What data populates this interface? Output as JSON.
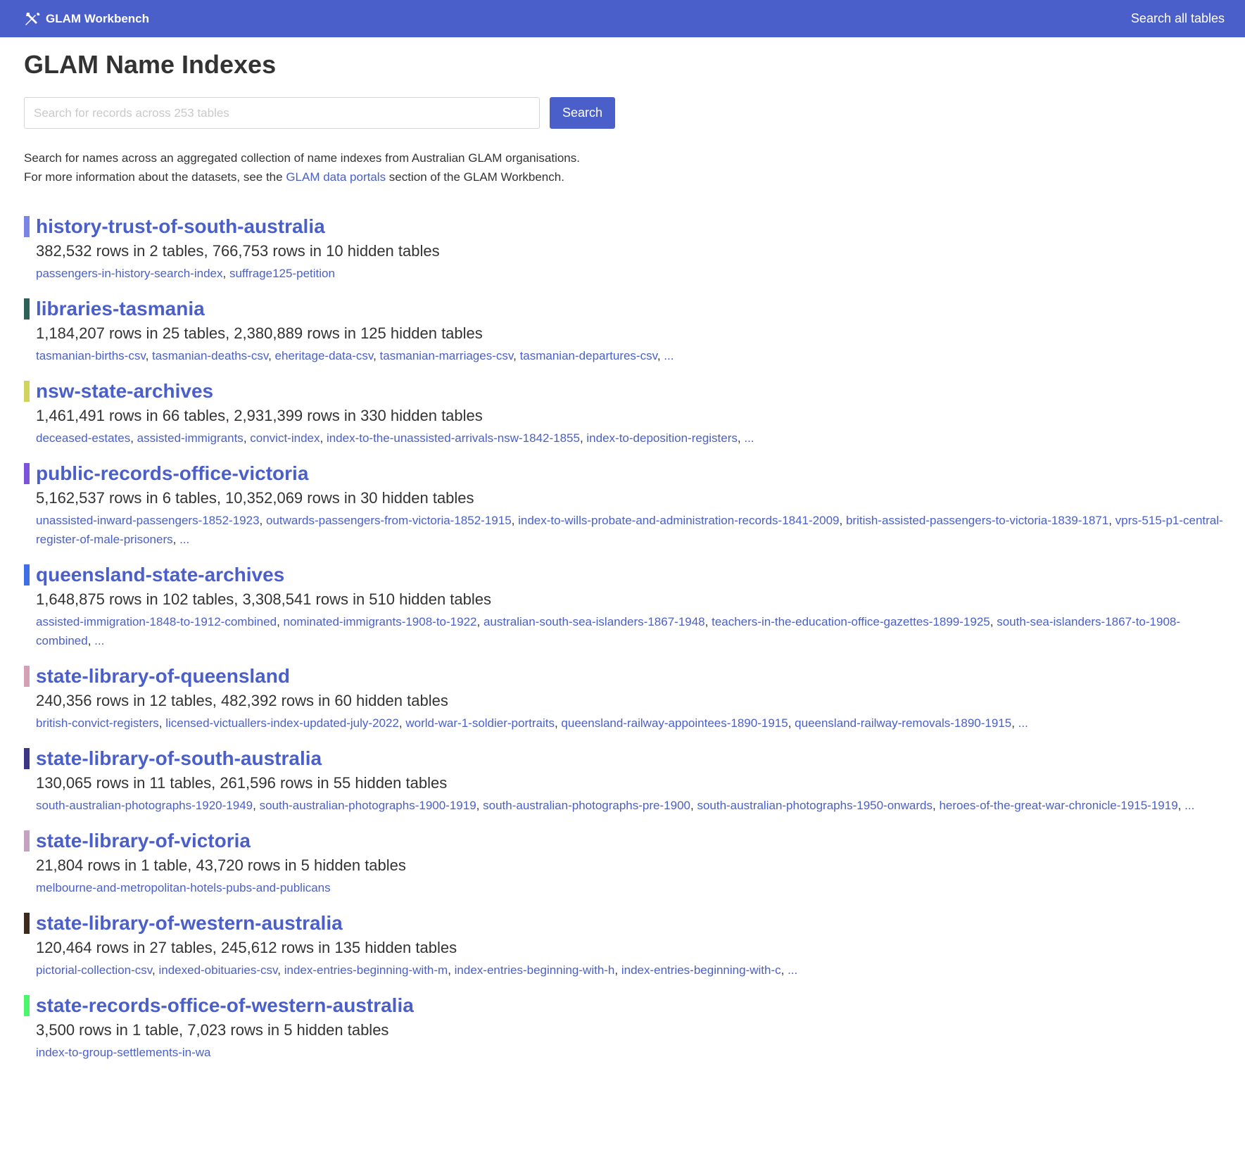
{
  "nav": {
    "brand": "GLAM Workbench",
    "search_all": "Search all tables"
  },
  "page": {
    "title": "GLAM Name Indexes",
    "search_placeholder": "Search for records across 253 tables",
    "search_button": "Search",
    "intro_line1": "Search for names across an aggregated collection of name indexes from Australian GLAM organisations.",
    "intro_line2_before": "For more information about the datasets, see the ",
    "intro_link": "GLAM data portals",
    "intro_line2_after": " section of the GLAM Workbench."
  },
  "databases": [
    {
      "name": "history-trust-of-south-australia",
      "color": "#7b85e6",
      "summary": "382,532 rows in 2 tables, 766,753 rows in 10 hidden tables",
      "tables": [
        "passengers-in-history-search-index",
        "suffrage125-petition"
      ],
      "more": false
    },
    {
      "name": "libraries-tasmania",
      "color": "#2e6157",
      "summary": "1,184,207 rows in 25 tables, 2,380,889 rows in 125 hidden tables",
      "tables": [
        "tasmanian-births-csv",
        "tasmanian-deaths-csv",
        "eheritage-data-csv",
        "tasmanian-marriages-csv",
        "tasmanian-departures-csv"
      ],
      "more": true
    },
    {
      "name": "nsw-state-archives",
      "color": "#cfd45e",
      "summary": "1,461,491 rows in 66 tables, 2,931,399 rows in 330 hidden tables",
      "tables": [
        "deceased-estates",
        "assisted-immigrants",
        "convict-index",
        "index-to-the-unassisted-arrivals-nsw-1842-1855",
        "index-to-deposition-registers"
      ],
      "more": true
    },
    {
      "name": "public-records-office-victoria",
      "color": "#7c53dc",
      "summary": "5,162,537 rows in 6 tables, 10,352,069 rows in 30 hidden tables",
      "tables": [
        "unassisted-inward-passengers-1852-1923",
        "outwards-passengers-from-victoria-1852-1915",
        "index-to-wills-probate-and-administration-records-1841-2009",
        "british-assisted-passengers-to-victoria-1839-1871",
        "vprs-515-p1-central-register-of-male-prisoners"
      ],
      "more": true
    },
    {
      "name": "queensland-state-archives",
      "color": "#3f6fe6",
      "summary": "1,648,875 rows in 102 tables, 3,308,541 rows in 510 hidden tables",
      "tables": [
        "assisted-immigration-1848-to-1912-combined",
        "nominated-immigrants-1908-to-1922",
        "australian-south-sea-islanders-1867-1948",
        "teachers-in-the-education-office-gazettes-1899-1925",
        "south-sea-islanders-1867-to-1908-combined"
      ],
      "more": true
    },
    {
      "name": "state-library-of-queensland",
      "color": "#d4a0b4",
      "summary": "240,356 rows in 12 tables, 482,392 rows in 60 hidden tables",
      "tables": [
        "british-convict-registers",
        "licensed-victuallers-index-updated-july-2022",
        "world-war-1-soldier-portraits",
        "queensland-railway-appointees-1890-1915",
        "queensland-railway-removals-1890-1915"
      ],
      "more": true
    },
    {
      "name": "state-library-of-south-australia",
      "color": "#3a3585",
      "summary": "130,065 rows in 11 tables, 261,596 rows in 55 hidden tables",
      "tables": [
        "south-australian-photographs-1920-1949",
        "south-australian-photographs-1900-1919",
        "south-australian-photographs-pre-1900",
        "south-australian-photographs-1950-onwards",
        "heroes-of-the-great-war-chronicle-1915-1919"
      ],
      "more": true
    },
    {
      "name": "state-library-of-victoria",
      "color": "#c4a2c0",
      "summary": "21,804 rows in 1 table, 43,720 rows in 5 hidden tables",
      "tables": [
        "melbourne-and-metropolitan-hotels-pubs-and-publicans"
      ],
      "more": false
    },
    {
      "name": "state-library-of-western-australia",
      "color": "#3d2b1f",
      "summary": "120,464 rows in 27 tables, 245,612 rows in 135 hidden tables",
      "tables": [
        "pictorial-collection-csv",
        "indexed-obituaries-csv",
        "index-entries-beginning-with-m",
        "index-entries-beginning-with-h",
        "index-entries-beginning-with-c"
      ],
      "more": true
    },
    {
      "name": "state-records-office-of-western-australia",
      "color": "#4cf56a",
      "summary": "3,500 rows in 1 table, 7,023 rows in 5 hidden tables",
      "tables": [
        "index-to-group-settlements-in-wa"
      ],
      "more": false
    }
  ],
  "more_label": "..."
}
